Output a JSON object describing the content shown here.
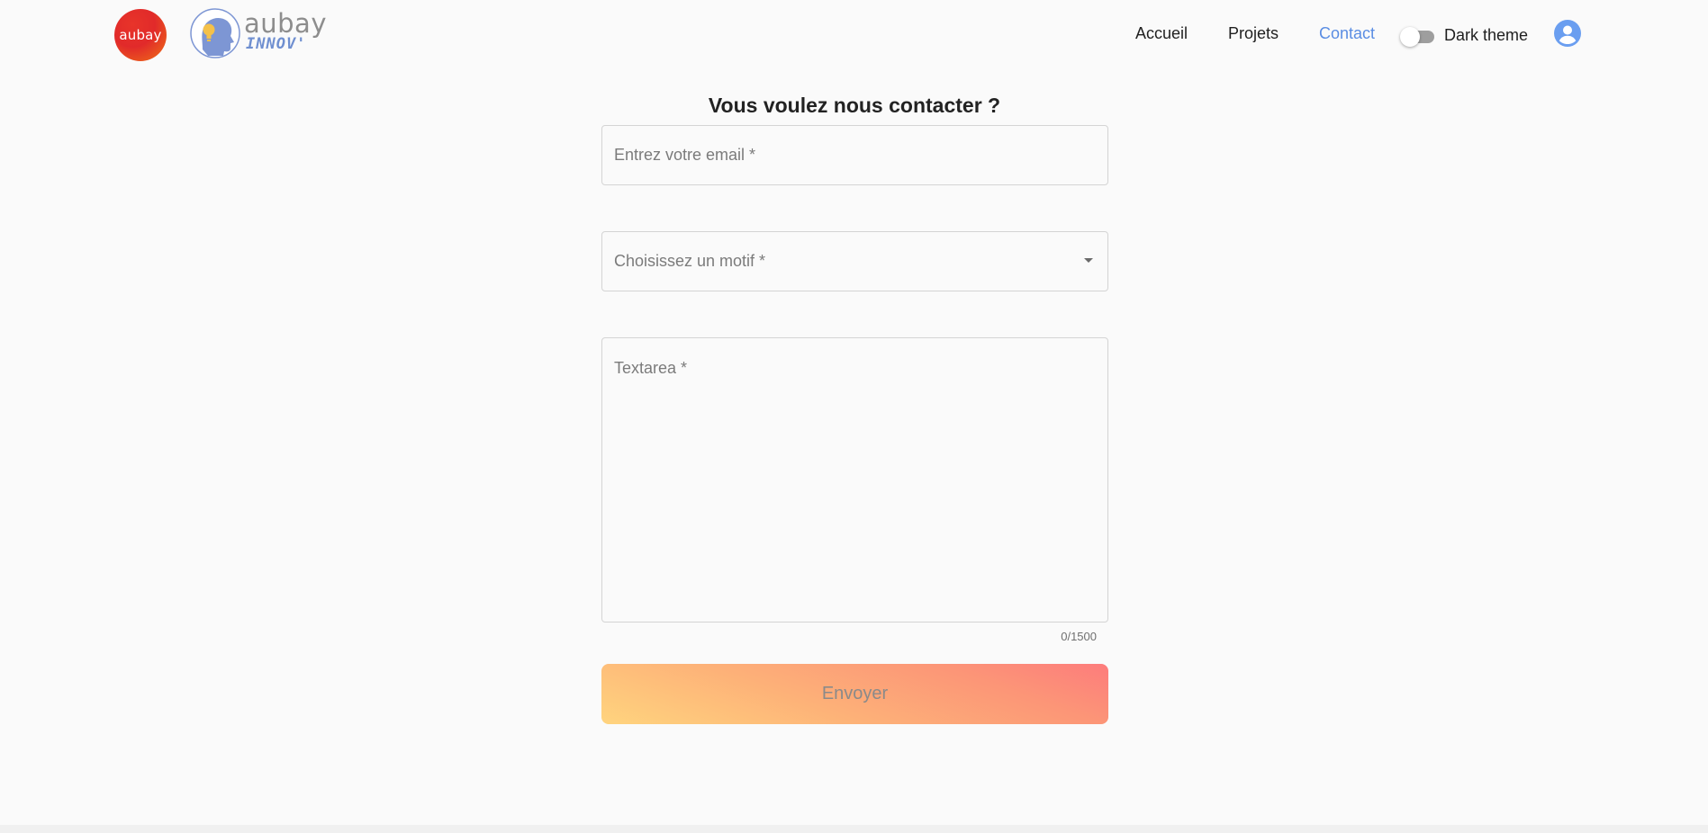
{
  "branding": {
    "logo_text": "aubay",
    "innov_brand": "aubay",
    "innov_tagline": "INNOV'",
    "logo_color": "#e32a2a",
    "innov_color": "#6f8fd0"
  },
  "nav": {
    "items": [
      {
        "label": "Accueil",
        "active": false
      },
      {
        "label": "Projets",
        "active": false
      },
      {
        "label": "Contact",
        "active": true
      }
    ],
    "active_color": "#5a8de3"
  },
  "theme_toggle": {
    "label": "Dark theme",
    "checked": false
  },
  "account": {
    "icon": "account-circle-icon",
    "color": "#6a9ef0"
  },
  "form": {
    "title": "Vous voulez nous contacter ?",
    "email": {
      "placeholder": "Entrez votre email *",
      "value": ""
    },
    "motif": {
      "placeholder": "Choisissez un motif *",
      "selected": ""
    },
    "message": {
      "placeholder": "Textarea *",
      "value": "",
      "counter": "0/1500"
    },
    "submit_label": "Envoyer"
  }
}
